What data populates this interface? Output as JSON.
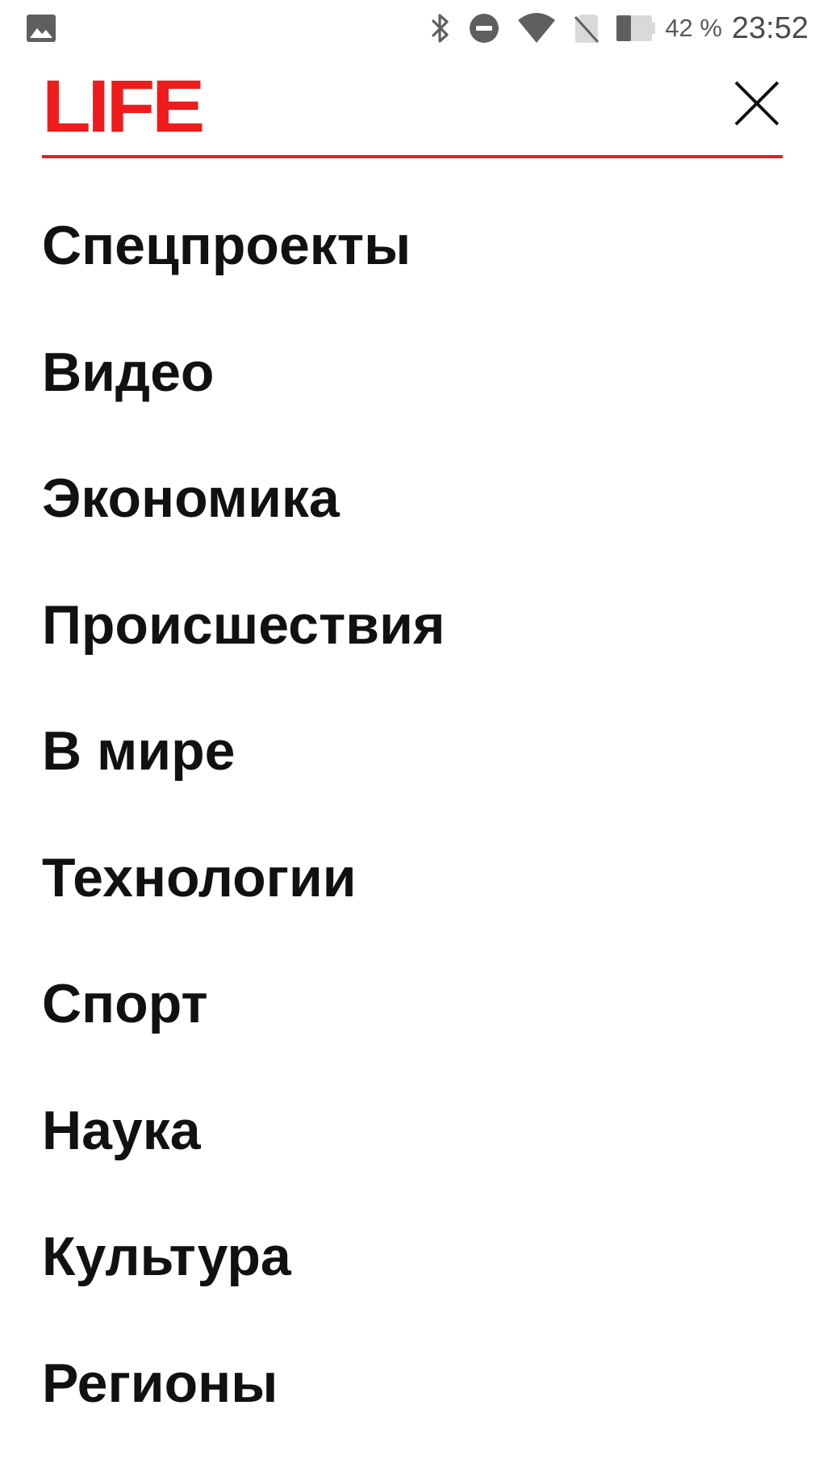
{
  "status_bar": {
    "left_icons": [
      "image-icon"
    ],
    "right_icons": [
      "bluetooth-icon",
      "do-not-disturb-icon",
      "wifi-icon",
      "no-sim-icon",
      "battery-icon"
    ],
    "battery_percent": "42 %",
    "time": "23:52"
  },
  "header": {
    "logo": "LIFE",
    "accent_color": "#ee1c1c",
    "close_icon": "close-icon"
  },
  "menu": {
    "items": [
      {
        "label": "Спецпроекты"
      },
      {
        "label": "Видео"
      },
      {
        "label": "Экономика"
      },
      {
        "label": "Происшествия"
      },
      {
        "label": "В мире"
      },
      {
        "label": "Технологии"
      },
      {
        "label": "Спорт"
      },
      {
        "label": "Наука"
      },
      {
        "label": "Культура"
      },
      {
        "label": "Регионы"
      }
    ]
  }
}
